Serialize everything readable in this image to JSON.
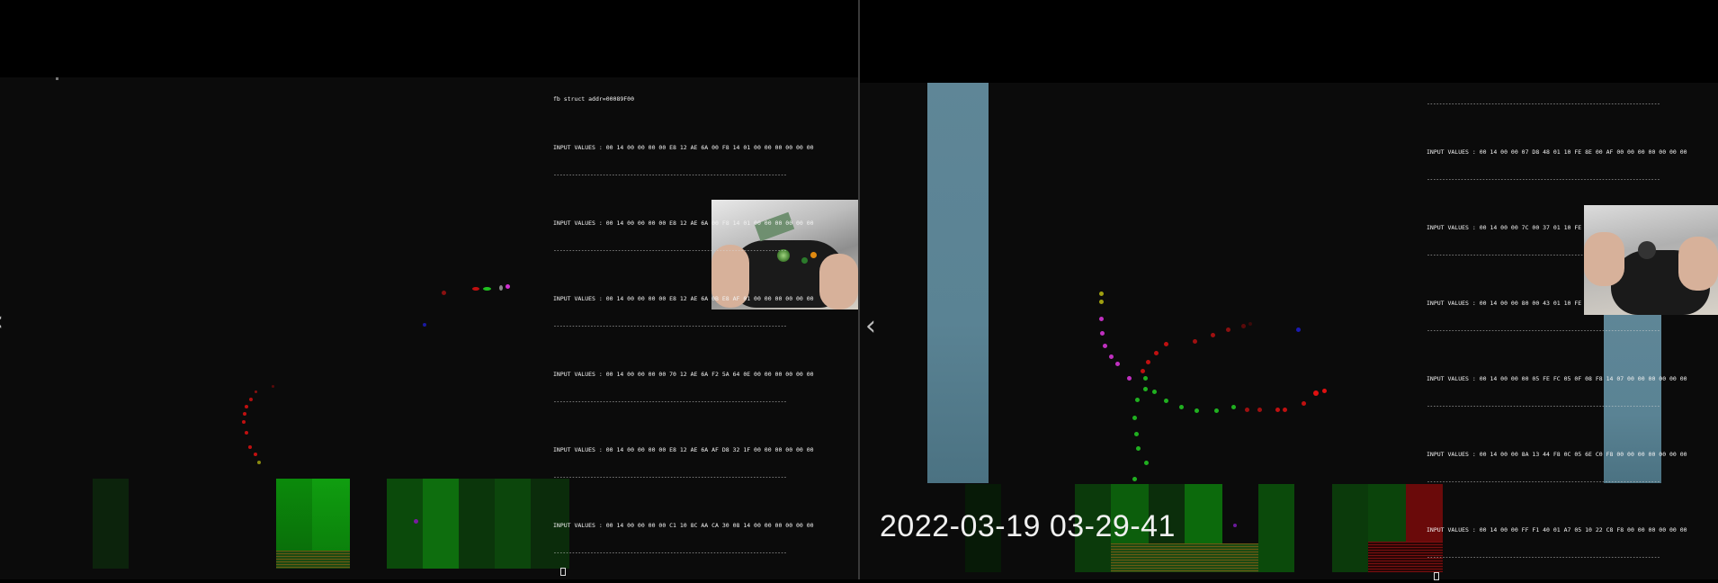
{
  "left_panel": {
    "console": {
      "header": "fb struct addr=00089F00",
      "lines": [
        "INPUT VALUES : 00 14 00 00 00 00 E8 12 AE 6A 00 F8 14 01 00 00 00 00 00 00",
        "INPUT VALUES : 00 14 00 00 00 00 E8 12 AE 6A 00 F8 14 01 00 00 00 00 00 00",
        "INPUT VALUES : 00 14 00 00 00 00 E8 12 AE 6A 0B E8 AF 01 00 00 00 00 00 00",
        "INPUT VALUES : 00 14 00 00 00 00 70 12 AE 6A F2 5A 64 0E 00 00 00 00 00 00",
        "INPUT VALUES : 00 14 00 00 00 00 E8 12 AE 6A AF D8 32 1F 00 00 00 00 00 00",
        "INPUT VALUES : 00 14 00 00 00 00 C1 10 8C AA CA 30 08 14 00 00 00 00 00 00"
      ]
    },
    "back_glyph": "‹"
  },
  "right_panel": {
    "console": {
      "lines": [
        "INPUT VALUES : 00 14 00 00 07 D8 48 01 10 FE 8E 00 AF 00 00 00 00 00 00 00",
        "INPUT VALUES : 00 14 00 00 7C 00 37 01 10 FE 79 00 AF 00 00 00 00 00 00 00",
        "INPUT VALUES : 00 14 00 00 80 00 43 01 10 FE 79 00 AF 00 00 00 00 00 00 00",
        "INPUT VALUES : 00 14 00 00 00 05 FE FC 05 0F 08 F8 14 07 00 00 00 00 00 00",
        "INPUT VALUES : 00 14 00 00 8A 13 44 F8 0C 05 6E C0 F8 00 00 00 00 00 00 00",
        "INPUT VALUES : 00 14 00 00 FF F1 40 01 A7 05 10 22 C8 F8 00 00 00 00 00 00"
      ]
    },
    "back_glyph": "‹",
    "timestamp": "2022-03-19 03-29-41"
  },
  "separator": "----------------------------------------------------------------------------",
  "colors": {
    "background": "#000000",
    "stage": "#0b0b0b",
    "pillar": "#5a8394",
    "green_bar": "#0a8a0a",
    "red_bar": "#7a0a0a"
  }
}
